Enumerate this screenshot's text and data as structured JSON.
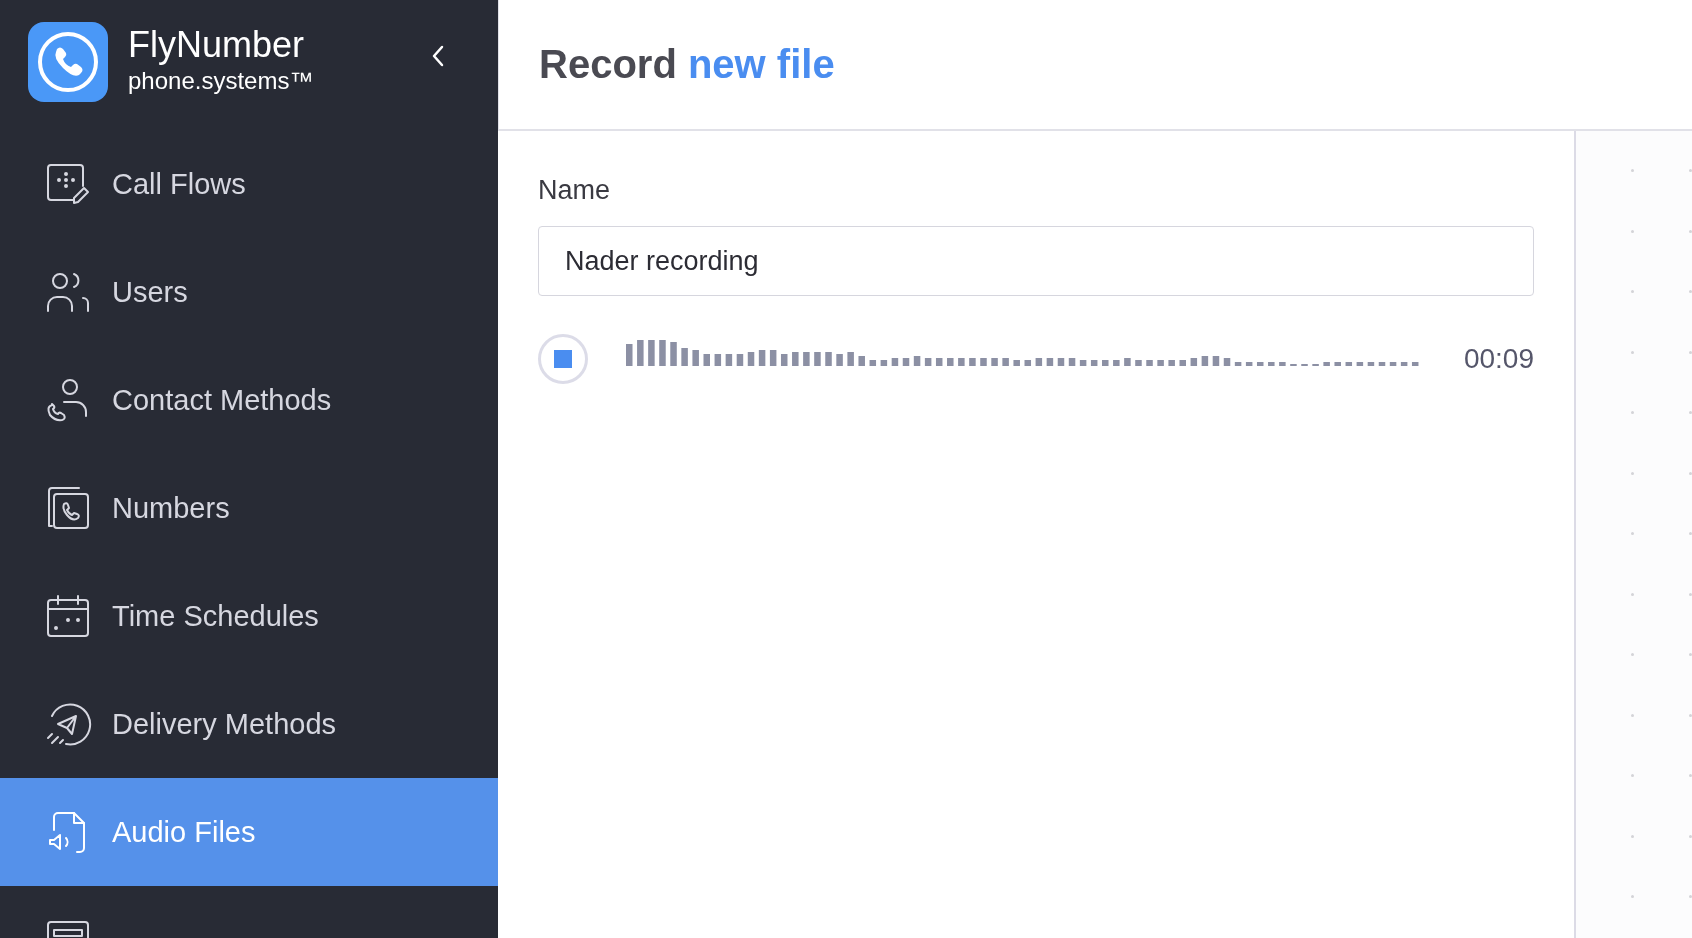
{
  "sidebar": {
    "brand": {
      "name": "FlyNumber",
      "tagline": "phone.systems™"
    },
    "items": [
      {
        "label": "Call Flows",
        "selected": false
      },
      {
        "label": "Users",
        "selected": false
      },
      {
        "label": "Contact Methods",
        "selected": false
      },
      {
        "label": "Numbers",
        "selected": false
      },
      {
        "label": "Time Schedules",
        "selected": false
      },
      {
        "label": "Delivery Methods",
        "selected": false
      },
      {
        "label": "Audio Files",
        "selected": true
      },
      {
        "selected": false
      }
    ]
  },
  "header": {
    "title": "Record **new file**"
  },
  "form": {
    "name_label": "Name",
    "name_value": "Nader recording",
    "recorder": {
      "recording": true,
      "time": "00:09"
    }
  }
}
